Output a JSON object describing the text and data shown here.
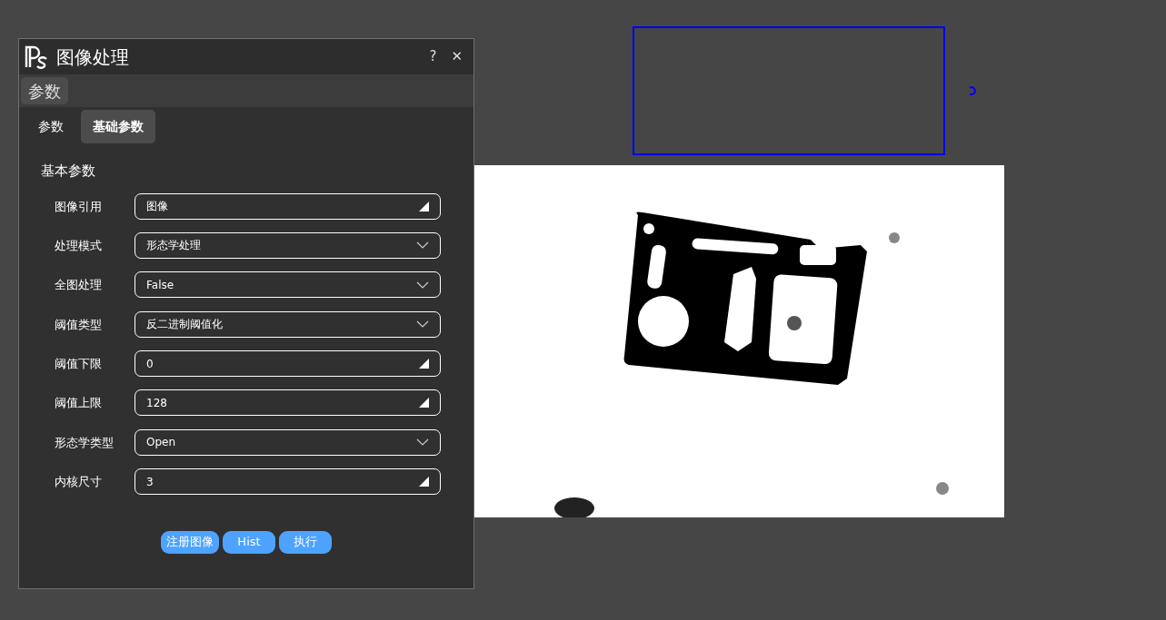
{
  "window": {
    "title": "图像处理",
    "controls": [
      "?",
      "✕"
    ]
  },
  "group_tabs": [
    {
      "label": "参数",
      "selected": true
    }
  ],
  "tabs": [
    {
      "label": "参数",
      "selected": false
    },
    {
      "label": "基础参数",
      "selected": true
    }
  ],
  "section_title": "基本参数",
  "fields": [
    {
      "label": "图像引用",
      "value": "图像",
      "kind": "spin"
    },
    {
      "label": "处理模式",
      "value": "形态学处理",
      "kind": "combo"
    },
    {
      "label": "全图处理",
      "value": "False",
      "kind": "combo"
    },
    {
      "label": "阈值类型",
      "value": "反二进制阈值化",
      "kind": "combo"
    },
    {
      "label": "阈值下限",
      "value": "0",
      "kind": "spin"
    },
    {
      "label": "阈值上限",
      "value": "128",
      "kind": "spin"
    },
    {
      "label": "形态学类型",
      "value": "Open",
      "kind": "combo"
    },
    {
      "label": "内核尺寸",
      "value": "3",
      "kind": "spin"
    }
  ],
  "buttons": [
    "注册图像",
    "Hist",
    "执行"
  ]
}
